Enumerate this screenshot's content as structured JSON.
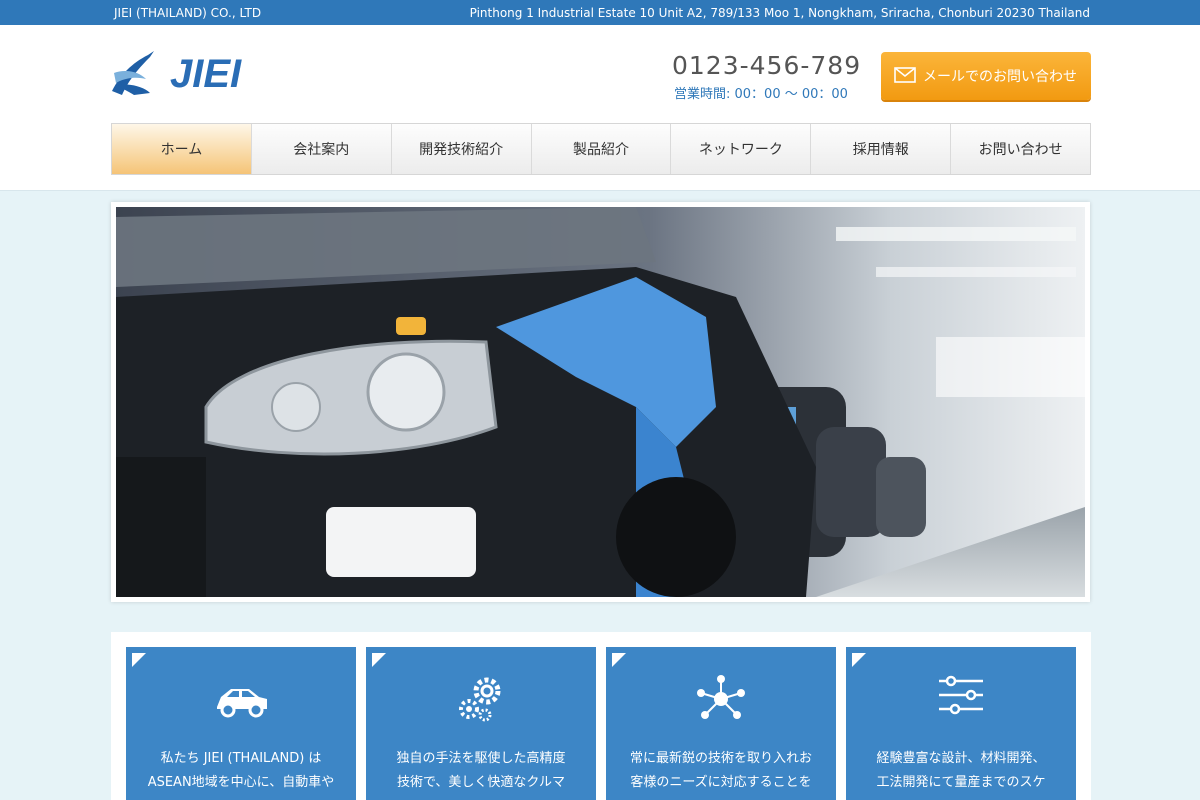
{
  "topbar": {
    "company": "JIEI (THAILAND) CO., LTD",
    "address": "Pinthong 1 Industrial Estate 10 Unit A2, 789/133 Moo 1, Nongkham, Sriracha, Chonburi 20230 Thailand"
  },
  "header": {
    "logo_text": "JIEI",
    "phone": "0123-456-789",
    "hours": "営業時間: 00：00 〜 00：00",
    "mail_button": "メールでのお問い合わせ"
  },
  "nav": {
    "items": [
      "ホーム",
      "会社案内",
      "開発技術紹介",
      "製品紹介",
      "ネットワーク",
      "採用情報",
      "お問い合わせ"
    ],
    "active_index": 0
  },
  "features": [
    {
      "icon": "car-icon",
      "line1": "私たち JIEI (THAILAND) は",
      "line2": "ASEAN地域を中心に、自動車や"
    },
    {
      "icon": "gears-icon",
      "line1": "独自の手法を駆使した高精度",
      "line2": "技術で、美しく快適なクルマ"
    },
    {
      "icon": "network-icon",
      "line1": "常に最新鋭の技術を取り入れお",
      "line2": "客様のニーズに対応することを"
    },
    {
      "icon": "sliders-icon",
      "line1": "経験豊富な設計、材料開発、",
      "line2": "工法開発にて量産までのスケ"
    }
  ],
  "colors": {
    "topbar": "#2f78b9",
    "accent_orange": "#f5a623",
    "card_blue": "#3d86c6",
    "page_bg": "#e6f3f7"
  }
}
